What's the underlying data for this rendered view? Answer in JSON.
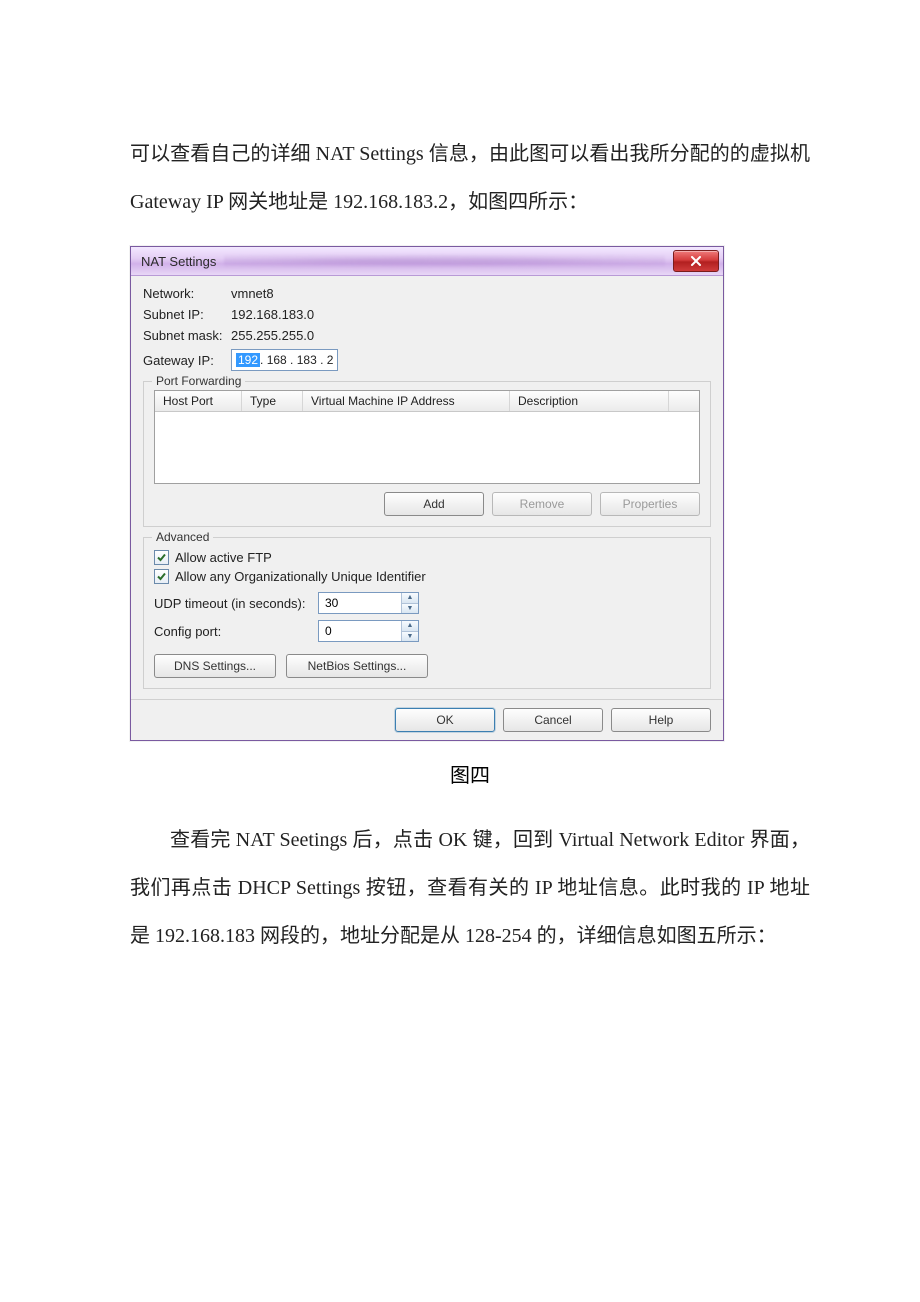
{
  "para1": "可以查看自己的详细 NAT Settings 信息，由此图可以看出我所分配的的虚拟机 Gateway IP 网关地址是 192.168.183.2，如图四所示：",
  "caption1": "图四",
  "para2": "查看完 NAT Seetings 后，点击 OK 键，回到 Virtual Network Editor 界面，我们再点击 DHCP Settings 按钮，查看有关的 IP 地址信息。此时我的 IP 地址是 192.168.183 网段的，地址分配是从 128-254 的，详细信息如图五所示：",
  "dialog": {
    "title": "NAT Settings",
    "network_label": "Network:",
    "network_value": "vmnet8",
    "subnet_ip_label": "Subnet IP:",
    "subnet_ip_value": "192.168.183.0",
    "subnet_mask_label": "Subnet mask:",
    "subnet_mask_value": "255.255.255.0",
    "gateway_label": "Gateway IP:",
    "gateway_oct1": "192",
    "gateway_rest": " . 168 . 183 .  2",
    "port_forwarding_legend": "Port Forwarding",
    "columns": {
      "host_port": "Host Port",
      "type": "Type",
      "vm_ip": "Virtual Machine IP Address",
      "description": "Description"
    },
    "add_btn": "Add",
    "remove_btn": "Remove",
    "properties_btn": "Properties",
    "advanced_legend": "Advanced",
    "allow_active_ftp": "Allow active FTP",
    "allow_oui": "Allow any Organizationally Unique Identifier",
    "udp_timeout_label": "UDP timeout (in seconds):",
    "udp_timeout_value": "30",
    "config_port_label": "Config port:",
    "config_port_value": "0",
    "dns_settings_btn": "DNS Settings...",
    "netbios_settings_btn": "NetBios Settings...",
    "ok_btn": "OK",
    "cancel_btn": "Cancel",
    "help_btn": "Help"
  }
}
